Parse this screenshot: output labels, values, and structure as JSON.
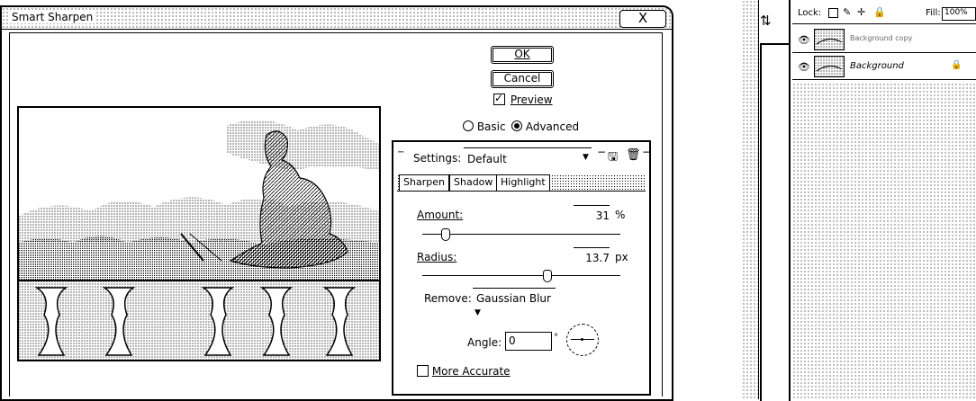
{
  "dialog": {
    "title": "Smart Sharpen",
    "close_glyph": "X",
    "ok_label": "OK",
    "cancel_label": "Cancel",
    "preview_label": "Preview",
    "preview_checked": true,
    "mode_basic": "Basic",
    "mode_advanced": "Advanced",
    "selected_mode": "Advanced"
  },
  "panel": {
    "settings_label": "Settings:",
    "settings_value": "Default",
    "tabs": [
      "Sharpen",
      "Shadow",
      "Highlight"
    ],
    "amount_label": "Amount:",
    "amount_value": "31",
    "amount_unit": "%",
    "amount_fraction": 0.12,
    "radius_label": "Radius:",
    "radius_value": "13.7",
    "radius_unit": "px",
    "radius_fraction": 0.63,
    "remove_label": "Remove:",
    "remove_value": "Gaussian Blur",
    "angle_label": "Angle:",
    "angle_value": "0",
    "angle_unit": "°",
    "more_accurate_label": "More Accurate",
    "more_accurate_checked": false
  },
  "layers": {
    "lock_label": "Lock:",
    "fill_label": "Fill:",
    "fill_value": "100%",
    "rows": [
      {
        "name": "Background copy"
      },
      {
        "name": "Background"
      }
    ]
  },
  "icons": {
    "ok_focus": "focus-ring",
    "settings_menu": "chevron-down-icon",
    "save": "save-icon",
    "delete": "trash-icon"
  }
}
